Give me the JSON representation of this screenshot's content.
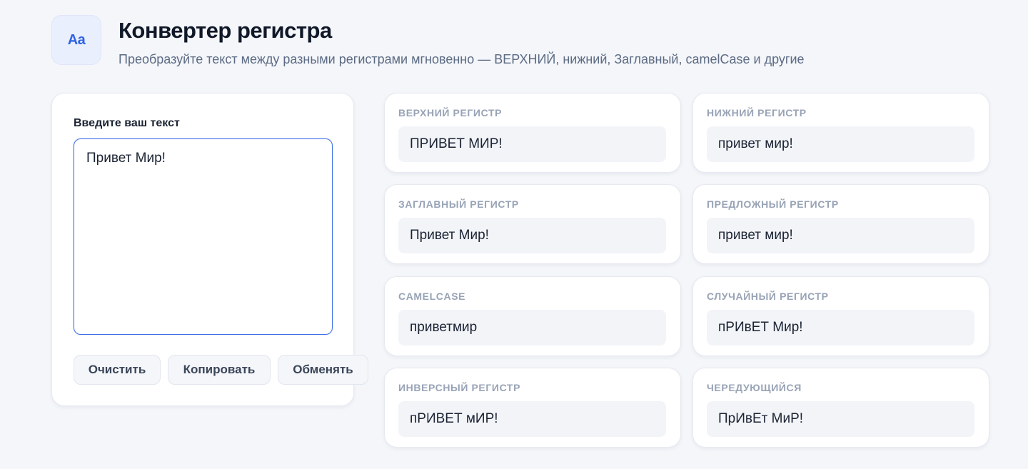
{
  "app": {
    "logo_text": "Aa",
    "title": "Конвертер регистра",
    "subtitle": "Преобразуйте текст между разными регистрами мгновенно — ВЕРХНИЙ, нижний, Заглавный, camelCase и другие",
    "accent_color": "#2f63e3"
  },
  "input": {
    "label": "Введите ваш текст",
    "value": "Привет Мир!"
  },
  "buttons": {
    "clear": "Очистить",
    "copy": "Копировать",
    "swap": "Обменять"
  },
  "outputs": [
    {
      "label": "ВЕРХНИЙ РЕГИСТР",
      "value": "ПРИВЕТ МИР!"
    },
    {
      "label": "НИЖНИЙ РЕГИСТР",
      "value": "привет мир!"
    },
    {
      "label": "ЗАГЛАВНЫЙ РЕГИСТР",
      "value": "Привет Мир!"
    },
    {
      "label": "ПРЕДЛОЖНЫЙ РЕГИСТР",
      "value": "привет мир!"
    },
    {
      "label": "CAMELCASE",
      "value": "приветмир"
    },
    {
      "label": "СЛУЧАЙНЫЙ РЕГИСТР",
      "value": "пРИвЕТ Мир!"
    },
    {
      "label": "ИНВЕРСНЫЙ РЕГИСТР",
      "value": "пРИВЕТ мИР!"
    },
    {
      "label": "ЧЕРЕДУЮЩИЙСЯ",
      "value": "ПрИвЕт МиР!"
    }
  ]
}
